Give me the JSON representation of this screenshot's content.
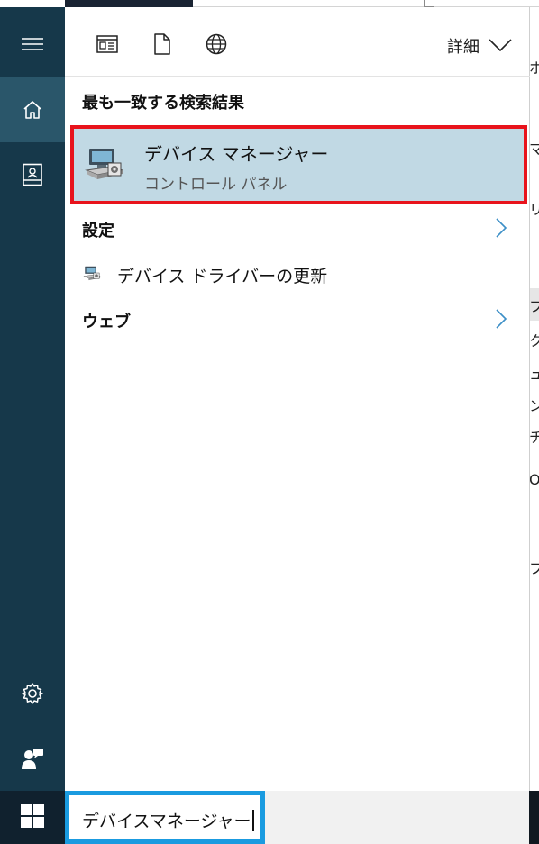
{
  "background": {
    "fragments": [
      "ホ",
      "マ",
      "リ",
      "フ",
      "ク",
      "ュ",
      "ン",
      "チ",
      "Or",
      "フ"
    ]
  },
  "rail": {
    "items": [
      {
        "icon": "hamburger-icon"
      },
      {
        "icon": "home-icon",
        "active": true
      },
      {
        "icon": "notebook-icon"
      },
      {
        "icon": "gear-icon"
      },
      {
        "icon": "feedback-icon"
      }
    ]
  },
  "toolbar": {
    "filters": [
      {
        "icon": "apps-filter-icon"
      },
      {
        "icon": "documents-filter-icon"
      },
      {
        "icon": "web-filter-icon"
      }
    ],
    "more_label": "詳細"
  },
  "results": {
    "best_match_heading": "最も一致する検索結果",
    "best_match": {
      "title": "デバイス マネージャー",
      "subtitle": "コントロール パネル",
      "icon": "device-manager-icon"
    },
    "settings_heading": "設定",
    "settings_items": [
      {
        "label": "デバイス ドライバーの更新",
        "icon": "device-manager-icon"
      }
    ],
    "web_heading": "ウェブ"
  },
  "taskbar": {
    "search_value": "デバイスマネージャー",
    "start_icon": "windows-logo-icon"
  },
  "colors": {
    "rail": "#16384a",
    "rail_active": "#2a566a",
    "selected_result": "#c1d9e4",
    "highlight_border": "#e8131c",
    "search_border": "#1a9be0"
  }
}
